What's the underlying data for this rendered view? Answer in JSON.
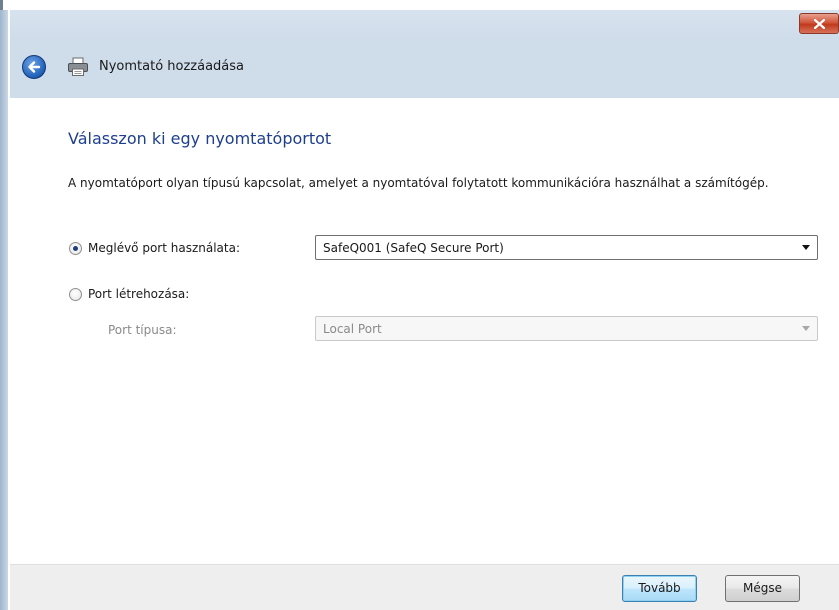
{
  "window": {
    "title": "Nyomtató hozzáadása"
  },
  "heading": "Válasszon ki egy nyomtatóportot",
  "description": "A nyomtatóport olyan típusú kapcsolat, amelyet a nyomtatóval folytatott kommunikációra használhat a számítógép.",
  "options": {
    "existing_port_label": "Meglévő port használata:",
    "existing_port_selected": true,
    "existing_port_value": "SafeQ001 (SafeQ Secure Port)",
    "create_port_label": "Port létrehozása:",
    "create_port_selected": false,
    "port_type_label": "Port típusa:",
    "port_type_value": "Local Port"
  },
  "buttons": {
    "next": "Tovább",
    "cancel": "Mégse"
  },
  "icons": {
    "close": "close-icon",
    "back": "back-arrow-icon",
    "printer": "printer-icon",
    "dropdown": "chevron-down-icon"
  },
  "colors": {
    "heading": "#1e3f8f",
    "close_button": "#c0391c",
    "header_band": "#cfdcea"
  }
}
